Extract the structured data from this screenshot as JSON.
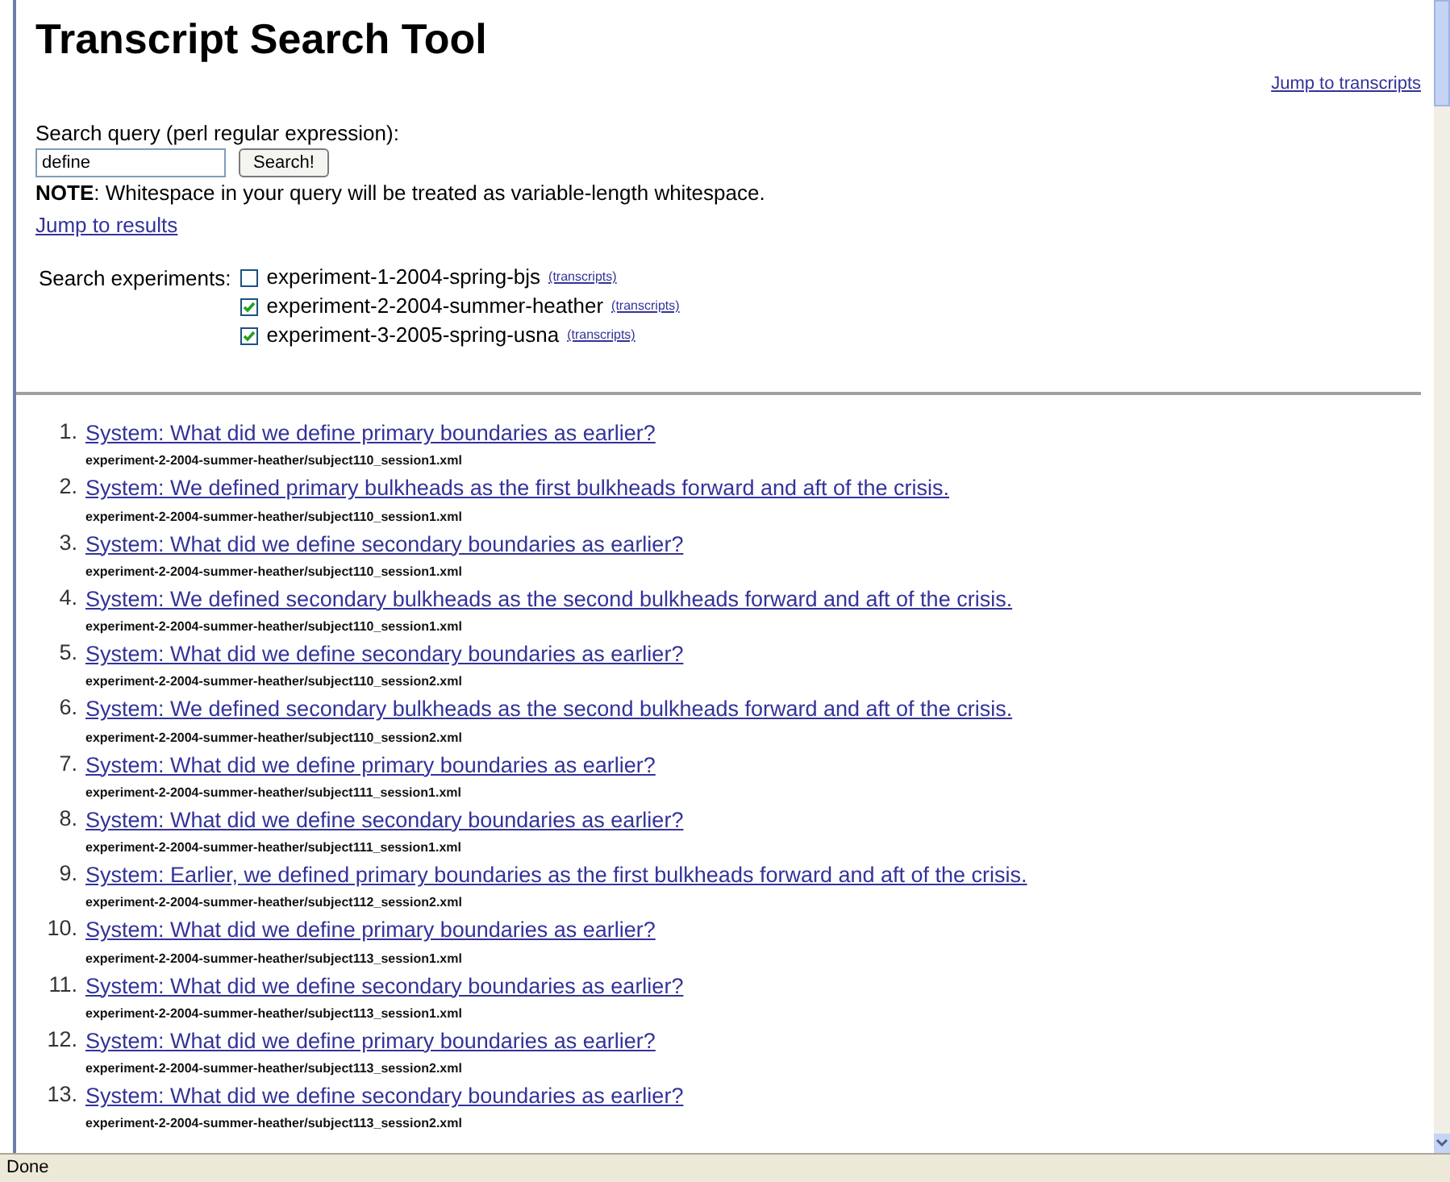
{
  "title": "Transcript Search Tool",
  "jump_to_transcripts": "Jump to transcripts",
  "search": {
    "label": "Search query (perl regular expression):",
    "value": "define",
    "button": "Search!"
  },
  "note": "**NOTE**: Whitespace in your query will be treated as variable-length whitespace.",
  "jump_to_results": "Jump to results",
  "experiments": {
    "label": "Search experiments:",
    "items": [
      {
        "name": "experiment-1-2004-spring-bjs",
        "checked": false,
        "link": "(transcripts)"
      },
      {
        "name": "experiment-2-2004-summer-heather",
        "checked": true,
        "link": "(transcripts)"
      },
      {
        "name": "experiment-3-2005-spring-usna",
        "checked": true,
        "link": "(transcripts)"
      }
    ]
  },
  "results": [
    {
      "number": "1.",
      "text": "System: What did we define primary boundaries as earlier?",
      "path": "experiment-2-2004-summer-heather/subject110_session1.xml"
    },
    {
      "number": "2.",
      "text": "System: We defined primary bulkheads as the first bulkheads forward and aft of the crisis.",
      "path": "experiment-2-2004-summer-heather/subject110_session1.xml"
    },
    {
      "number": "3.",
      "text": "System: What did we define secondary boundaries as earlier?",
      "path": "experiment-2-2004-summer-heather/subject110_session1.xml"
    },
    {
      "number": "4.",
      "text": "System: We defined secondary bulkheads as the second bulkheads forward and aft of the crisis.",
      "path": "experiment-2-2004-summer-heather/subject110_session1.xml"
    },
    {
      "number": "5.",
      "text": "System: What did we define secondary boundaries as earlier?",
      "path": "experiment-2-2004-summer-heather/subject110_session2.xml"
    },
    {
      "number": "6.",
      "text": "System: We defined secondary bulkheads as the second bulkheads forward and aft of the crisis.",
      "path": "experiment-2-2004-summer-heather/subject110_session2.xml"
    },
    {
      "number": "7.",
      "text": "System: What did we define primary boundaries as earlier?",
      "path": "experiment-2-2004-summer-heather/subject111_session1.xml"
    },
    {
      "number": "8.",
      "text": "System: What did we define secondary boundaries as earlier?",
      "path": "experiment-2-2004-summer-heather/subject111_session1.xml"
    },
    {
      "number": "9.",
      "text": "System: Earlier, we defined primary boundaries as the first bulkheads forward and aft of the crisis.",
      "path": "experiment-2-2004-summer-heather/subject112_session2.xml"
    },
    {
      "number": "10.",
      "text": "System: What did we define primary boundaries as earlier?",
      "path": "experiment-2-2004-summer-heather/subject113_session1.xml"
    },
    {
      "number": "11.",
      "text": "System: What did we define secondary boundaries as earlier?",
      "path": "experiment-2-2004-summer-heather/subject113_session1.xml"
    },
    {
      "number": "12.",
      "text": "System: What did we define primary boundaries as earlier?",
      "path": "experiment-2-2004-summer-heather/subject113_session2.xml"
    },
    {
      "number": "13.",
      "text": "System: What did we define secondary boundaries as earlier?",
      "path": "experiment-2-2004-summer-heather/subject113_session2.xml"
    }
  ],
  "status_bar": "Done"
}
